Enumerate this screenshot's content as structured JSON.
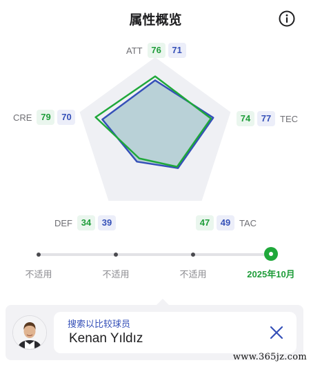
{
  "header": {
    "title": "属性概览",
    "info_icon": "info-circle-icon"
  },
  "attributes": [
    {
      "key": "att",
      "name": "ATT",
      "value_green": "76",
      "value_blue": "71"
    },
    {
      "key": "tec",
      "name": "TEC",
      "value_green": "74",
      "value_blue": "77"
    },
    {
      "key": "tac",
      "name": "TAC",
      "value_green": "47",
      "value_blue": "49"
    },
    {
      "key": "def",
      "name": "DEF",
      "value_green": "34",
      "value_blue": "39"
    },
    {
      "key": "cre",
      "name": "CRE",
      "value_green": "79",
      "value_blue": "70"
    }
  ],
  "chart_data": {
    "type": "radar",
    "axes": [
      "ATT",
      "TEC",
      "TAC",
      "DEF",
      "CRE"
    ],
    "series": [
      {
        "color": "#1fa83a",
        "values": [
          76,
          74,
          47,
          34,
          79
        ]
      },
      {
        "color": "#3550b8",
        "values": [
          71,
          77,
          49,
          39,
          70
        ]
      }
    ],
    "range": [
      0,
      100
    ]
  },
  "timeline": {
    "items": [
      {
        "label": "不适用",
        "active": false
      },
      {
        "label": "不适用",
        "active": false
      },
      {
        "label": "不适用",
        "active": false
      },
      {
        "label": "2025年10月",
        "active": true
      }
    ]
  },
  "search": {
    "label": "搜索以比较球员",
    "value": "Kenan Yıldız",
    "clear_icon": "close-icon"
  },
  "watermark": "www.365jz.com",
  "colors": {
    "green": "#1fa83a",
    "blue": "#3550b8",
    "panel": "#f2f2f5"
  }
}
